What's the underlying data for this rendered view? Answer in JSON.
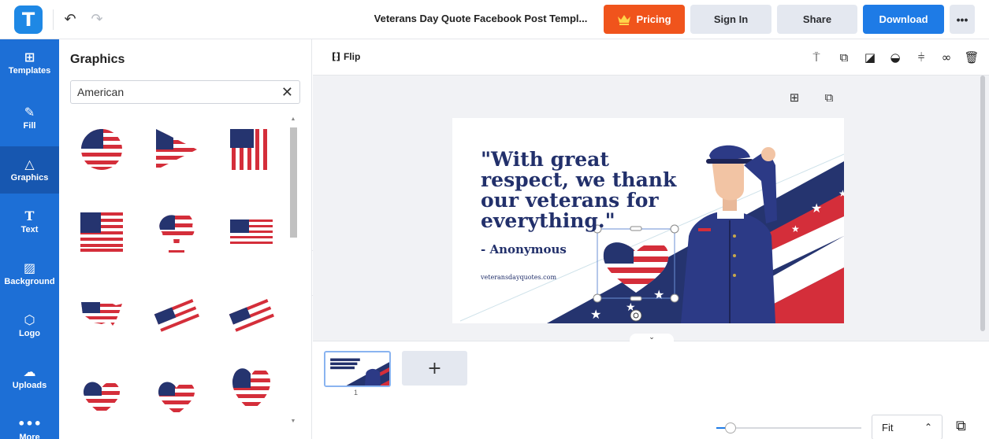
{
  "app": {
    "logo_letter": "T",
    "document_title": "Veterans Day Quote Facebook Post Templ..."
  },
  "header": {
    "undo_icon": "undo-icon",
    "redo_icon": "redo-icon",
    "pricing_label": "Pricing",
    "signin_label": "Sign In",
    "share_label": "Share",
    "download_label": "Download",
    "more_label": "•••",
    "colors": {
      "pricing": "#f0541c",
      "download": "#1e7be6",
      "neutral": "#e4e8f0"
    }
  },
  "rail": {
    "items": [
      {
        "label": "Templates",
        "icon": "templates-icon"
      },
      {
        "label": "Fill",
        "icon": "pencil-icon"
      },
      {
        "label": "Graphics",
        "icon": "shapes-icon",
        "active": true
      },
      {
        "label": "Text",
        "icon": "text-icon"
      },
      {
        "label": "Background",
        "icon": "background-icon"
      },
      {
        "label": "Logo",
        "icon": "logo-icon"
      },
      {
        "label": "Uploads",
        "icon": "upload-cloud-icon"
      },
      {
        "label": "More",
        "icon": "more-icon"
      }
    ],
    "color": "#1d6fd6"
  },
  "panel": {
    "title": "Graphics",
    "search_value": "American",
    "results": [
      "flag-circle",
      "flag-triangle",
      "flag-bars",
      "flag-rectangle",
      "flag-tree",
      "flag-waving",
      "flag-usa-map",
      "flag-brush-1",
      "flag-brush-2",
      "flag-heart-1",
      "flag-heart-2",
      "flag-heart-3"
    ]
  },
  "editor_toolbar": {
    "flip_label": "Flip",
    "tools": [
      "paint-roller-icon",
      "duplicate-icon",
      "layer-icon",
      "opacity-icon",
      "align-icon",
      "link-icon",
      "trash-icon"
    ]
  },
  "canvas": {
    "quote": "\"With great respect, we thank our veterans for everything.\"",
    "author": "- Anonymous",
    "website": "veteransdayquotes.com",
    "colors": {
      "navy": "#22306b",
      "red": "#d42e3a",
      "bg": "#ffffff"
    }
  },
  "pages": {
    "current_page": "1",
    "add_label": "+"
  },
  "zoom": {
    "level": 0.1,
    "fit_label": "Fit"
  }
}
